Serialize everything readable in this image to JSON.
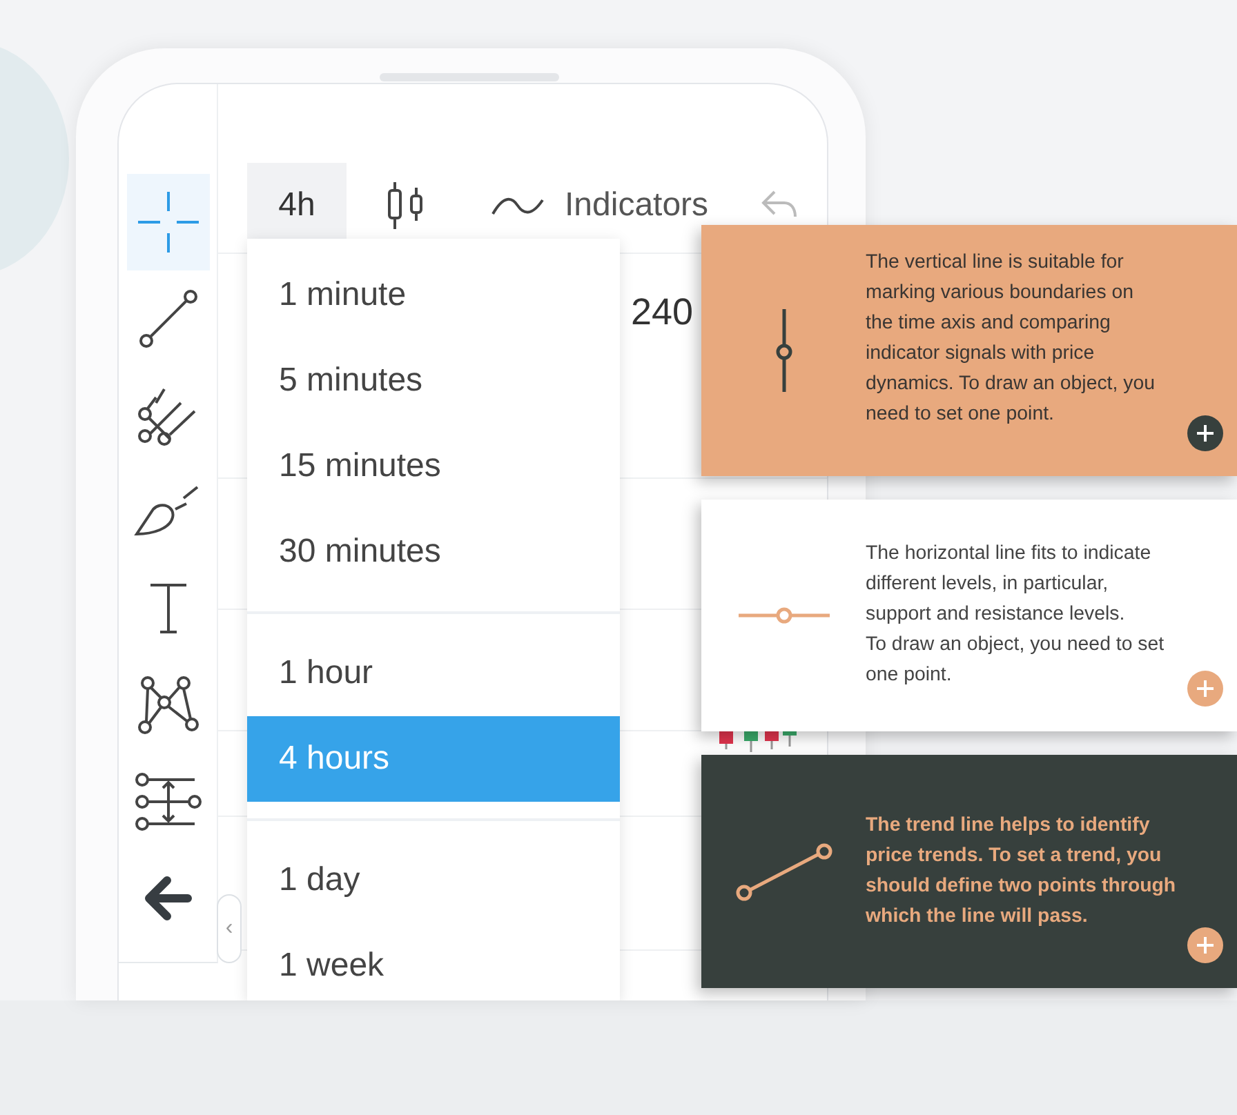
{
  "drawing_tools": [
    {
      "kind": "crosshair",
      "selected": true
    },
    {
      "kind": "trend-line",
      "selected": false
    },
    {
      "kind": "pitchfork",
      "selected": false
    },
    {
      "kind": "brush",
      "selected": false
    },
    {
      "kind": "text",
      "selected": false
    },
    {
      "kind": "pattern",
      "selected": false
    },
    {
      "kind": "levels",
      "selected": false
    },
    {
      "kind": "back-arrow",
      "selected": false
    }
  ],
  "toolbar": {
    "interval": "4h",
    "indicators": "Indicators"
  },
  "panel_handle": "‹",
  "chart": {
    "price_label": "240"
  },
  "interval_menu": {
    "groups": [
      {
        "items": [
          {
            "label": "1 minute",
            "selected": false
          },
          {
            "label": "5 minutes",
            "selected": false
          },
          {
            "label": "15 minutes",
            "selected": false
          },
          {
            "label": "30 minutes",
            "selected": false
          }
        ]
      },
      {
        "items": [
          {
            "label": "1 hour",
            "selected": false
          },
          {
            "label": "4 hours",
            "selected": true
          }
        ]
      },
      {
        "items": [
          {
            "label": "1 day",
            "selected": false
          },
          {
            "label": "1 week",
            "selected": false
          }
        ]
      }
    ]
  },
  "tip_cards": [
    {
      "kind": "vertical-line",
      "color": "#e8a97e",
      "text": "The vertical line is suitable for\nmarking various boundaries on\nthe time axis and comparing\nindicator signals with price\ndynamics. To draw an object, you\nneed to set one point."
    },
    {
      "kind": "horizontal-line",
      "color": "#ffffff",
      "text": "The horizontal line fits to indicate\ndifferent levels, in particular,\nsupport and resistance levels.\nTo draw an object, you need to set\none point."
    },
    {
      "kind": "trend-line",
      "color": "#37403d",
      "text": "The trend line helps to identify\nprice trends. To set a trend, you\nshould define two points through\nwhich the line will pass."
    }
  ]
}
